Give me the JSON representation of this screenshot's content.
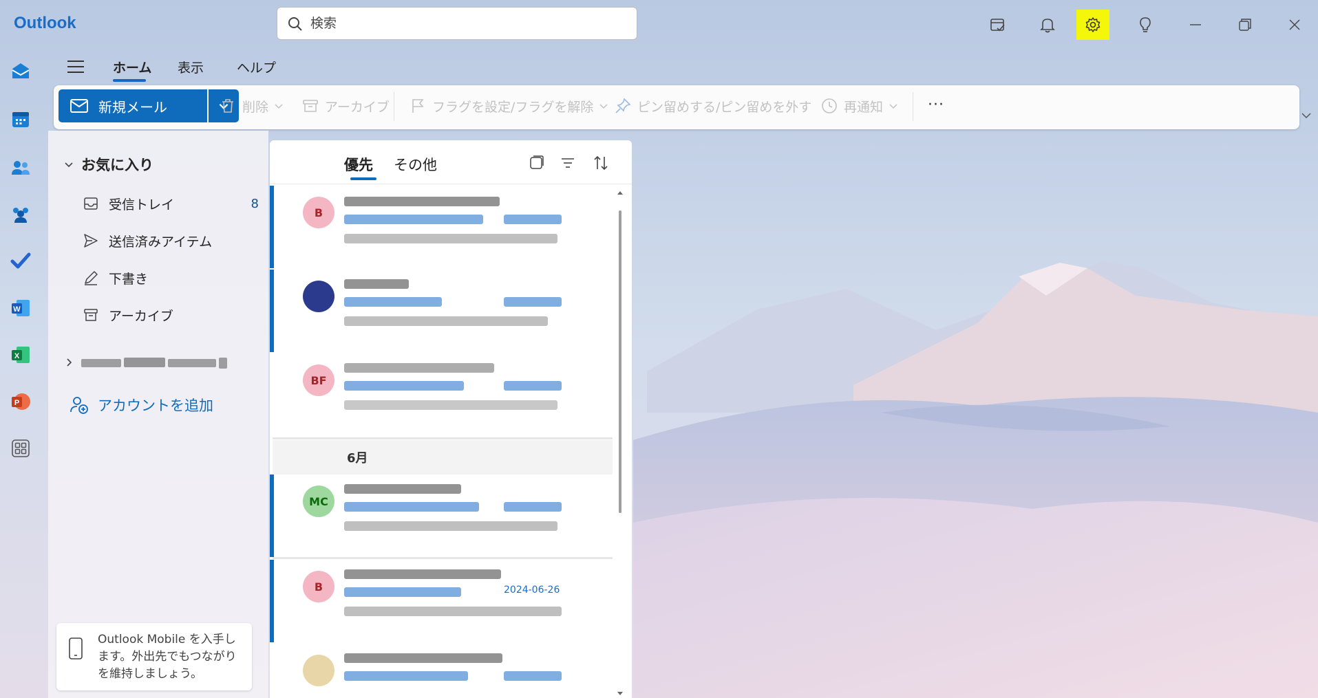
{
  "app": {
    "name": "Outlook"
  },
  "search": {
    "placeholder": "検索"
  },
  "titlebar_buttons": [
    {
      "name": "my-day-icon"
    },
    {
      "name": "bell-icon"
    },
    {
      "name": "gear-icon",
      "highlight_color": "#f5f70a"
    },
    {
      "name": "lightbulb-icon"
    },
    {
      "name": "minimize-icon"
    },
    {
      "name": "restore-icon"
    },
    {
      "name": "close-icon"
    }
  ],
  "rail": [
    "mail-icon",
    "calendar-icon",
    "people-icon",
    "groups-icon",
    "todo-icon",
    "word-icon",
    "excel-icon",
    "powerpoint-icon",
    "apps-icon"
  ],
  "ribbon_tabs": [
    {
      "label": "ホーム",
      "active": true
    },
    {
      "label": "表示"
    },
    {
      "label": "ヘルプ"
    }
  ],
  "toolbar": {
    "new_mail": "新規メール",
    "delete": "削除",
    "archive": "アーカイブ",
    "flag": "フラグを設定/フラグを解除",
    "pin": "ピン留めする/ピン留めを外す",
    "snooze": "再通知",
    "more": "···"
  },
  "folders": {
    "favorites_label": "お気に入り",
    "items": [
      {
        "label": "受信トレイ",
        "count": "8",
        "icon": "inbox-icon"
      },
      {
        "label": "送信済みアイテム",
        "icon": "send-icon"
      },
      {
        "label": "下書き",
        "icon": "draft-icon"
      },
      {
        "label": "アーカイブ",
        "icon": "archive-icon"
      }
    ],
    "add_account": "アカウントを追加",
    "mobile_promo": "Outlook Mobile を入手します。外出先でもつながりを維持しましょう。"
  },
  "message_list": {
    "tabs": [
      {
        "label": "優先",
        "active": true
      },
      {
        "label": "その他"
      }
    ],
    "messages": [
      {
        "avatar_text": "B",
        "avatar_bg": "#f4b6c2",
        "avatar_fg": "#a4262c",
        "date": "",
        "unread": true
      },
      {
        "avatar_text": "",
        "avatar_bg": "#2b3a8c",
        "avatar_fg": "#ffffff",
        "date": "",
        "unread": true
      },
      {
        "avatar_text": "BF",
        "avatar_bg": "#f4b6c2",
        "avatar_fg": "#a4262c",
        "date": "",
        "unread": false
      },
      {
        "avatar_text": "MC",
        "avatar_bg": "#9fd89f",
        "avatar_fg": "#0b6a0b",
        "date": "",
        "unread": true
      },
      {
        "avatar_text": "B",
        "avatar_bg": "#f4b6c2",
        "avatar_fg": "#a4262c",
        "date": "2024-06-26",
        "unread": true
      },
      {
        "avatar_text": "",
        "avatar_bg": "#e8d6a8",
        "avatar_fg": "#8a6d1a",
        "date": "",
        "unread": false
      }
    ],
    "section_label": "6月"
  },
  "colors": {
    "accent": "#0f6cbd",
    "unread_count": "#0f548c"
  }
}
